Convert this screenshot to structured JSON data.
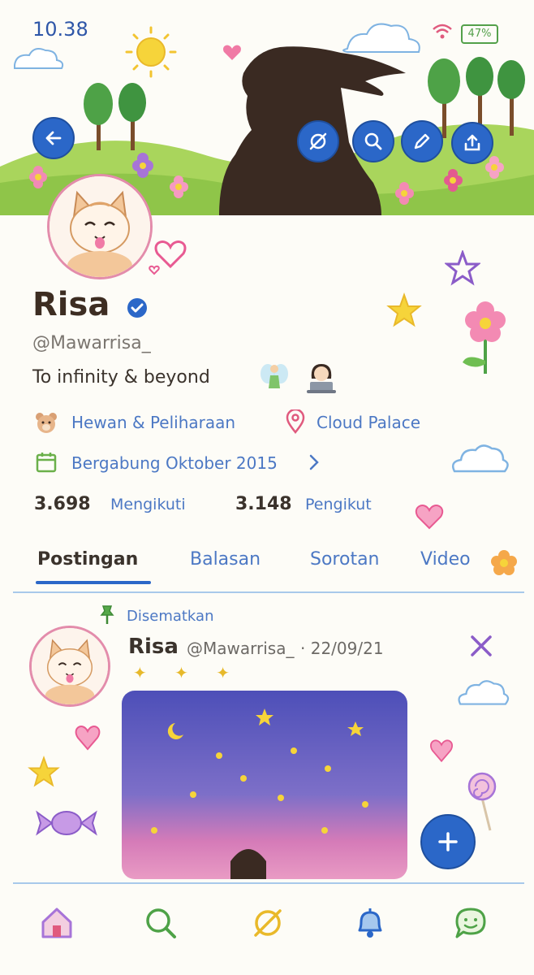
{
  "status_bar": {
    "time": "10.38",
    "battery": "47%"
  },
  "profile": {
    "name": "Risa",
    "handle": "@Mawarrisa_",
    "bio": "To infinity & beyond",
    "category": "Hewan & Peliharaan",
    "location": "Cloud Palace",
    "joined": "Bergabung Oktober 2015",
    "following_count": "3.698",
    "following_label": "Mengikuti",
    "followers_count": "3.148",
    "followers_label": "Pengikut"
  },
  "tabs": [
    {
      "label": "Postingan",
      "active": true
    },
    {
      "label": "Balasan",
      "active": false
    },
    {
      "label": "Sorotan",
      "active": false
    },
    {
      "label": "Video",
      "active": false
    }
  ],
  "post": {
    "pinned_label": "Disematkan",
    "author": "Risa",
    "handle": "@Mawarrisa_",
    "date": "· 22/09/21",
    "text": "✦ ✦ ✦"
  },
  "icons": {
    "back": "back-arrow-icon",
    "grok": "grok-icon",
    "search": "search-icon",
    "edit": "pencil-icon",
    "share": "share-icon",
    "compose": "plus-icon",
    "nav": [
      "home-icon",
      "search-icon",
      "grok-icon",
      "notifications-bell-icon",
      "messages-icon"
    ]
  },
  "colors": {
    "accent": "#2b67c8",
    "link": "#4c78c4",
    "text": "#3b332c"
  }
}
